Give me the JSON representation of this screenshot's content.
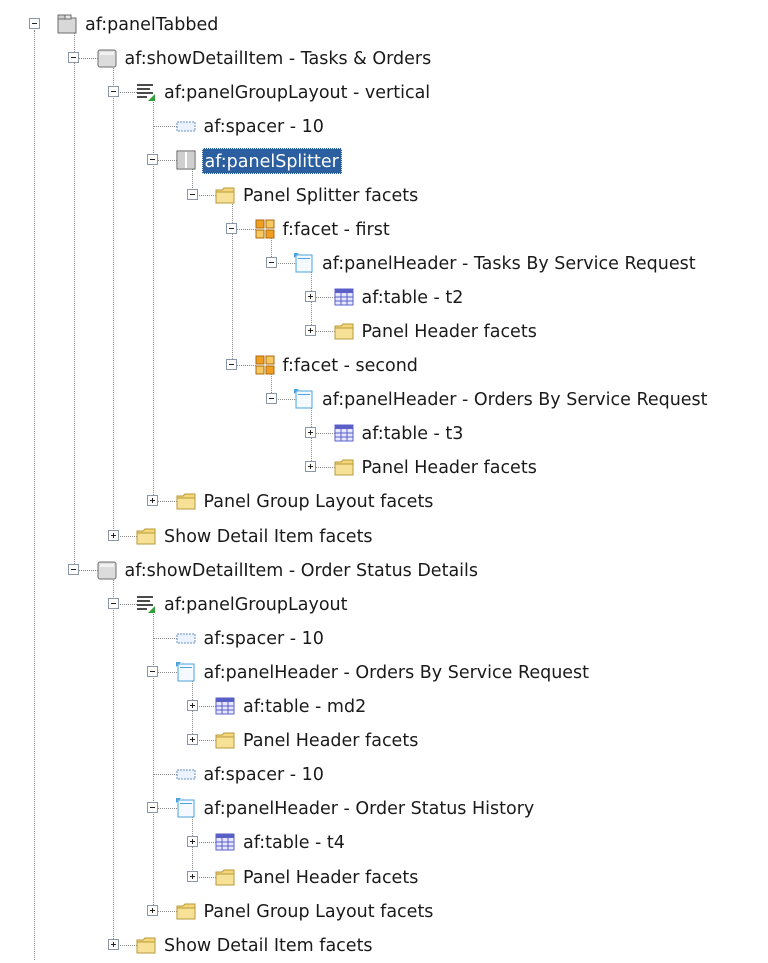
{
  "tree": {
    "nodes": [
      {
        "label": "af:panelTabbed",
        "depth": 0,
        "icon": "tabbed-icon",
        "expanded": true,
        "selected": false
      },
      {
        "label": "af:showDetailItem - Tasks & Orders",
        "depth": 1,
        "icon": "show-detail-item-icon",
        "expanded": true,
        "selected": false
      },
      {
        "label": "af:panelGroupLayout - vertical",
        "depth": 2,
        "icon": "panel-group-layout-icon",
        "expanded": true,
        "selected": false
      },
      {
        "label": "af:spacer - 10",
        "depth": 3,
        "icon": "spacer-icon",
        "expanded": null,
        "selected": false
      },
      {
        "label": "af:panelSplitter",
        "depth": 3,
        "icon": "panel-splitter-icon",
        "expanded": true,
        "selected": true
      },
      {
        "label": "Panel Splitter facets",
        "depth": 4,
        "icon": "folder-icon",
        "expanded": true,
        "selected": false
      },
      {
        "label": "f:facet - first",
        "depth": 5,
        "icon": "facet-icon",
        "expanded": true,
        "selected": false
      },
      {
        "label": "af:panelHeader - Tasks By Service Request",
        "depth": 6,
        "icon": "panel-header-icon",
        "expanded": true,
        "selected": false
      },
      {
        "label": "af:table - t2",
        "depth": 7,
        "icon": "table-icon",
        "expanded": false,
        "selected": false
      },
      {
        "label": "Panel Header facets",
        "depth": 7,
        "icon": "folder-icon",
        "expanded": false,
        "selected": false
      },
      {
        "label": "f:facet - second",
        "depth": 5,
        "icon": "facet-icon",
        "expanded": true,
        "selected": false
      },
      {
        "label": "af:panelHeader - Orders By Service Request",
        "depth": 6,
        "icon": "panel-header-icon",
        "expanded": true,
        "selected": false
      },
      {
        "label": "af:table - t3",
        "depth": 7,
        "icon": "table-icon",
        "expanded": false,
        "selected": false
      },
      {
        "label": "Panel Header facets",
        "depth": 7,
        "icon": "folder-icon",
        "expanded": false,
        "selected": false
      },
      {
        "label": "Panel Group Layout facets",
        "depth": 3,
        "icon": "folder-icon",
        "expanded": false,
        "selected": false
      },
      {
        "label": "Show Detail Item facets",
        "depth": 2,
        "icon": "folder-icon",
        "expanded": false,
        "selected": false
      },
      {
        "label": "af:showDetailItem - Order Status Details",
        "depth": 1,
        "icon": "show-detail-item-icon",
        "expanded": true,
        "selected": false
      },
      {
        "label": "af:panelGroupLayout",
        "depth": 2,
        "icon": "panel-group-layout-icon",
        "expanded": true,
        "selected": false
      },
      {
        "label": "af:spacer - 10",
        "depth": 3,
        "icon": "spacer-icon",
        "expanded": null,
        "selected": false
      },
      {
        "label": "af:panelHeader - Orders By Service Request",
        "depth": 3,
        "icon": "panel-header-icon",
        "expanded": true,
        "selected": false
      },
      {
        "label": "af:table - md2",
        "depth": 4,
        "icon": "table-icon",
        "expanded": false,
        "selected": false
      },
      {
        "label": "Panel Header facets",
        "depth": 4,
        "icon": "folder-icon",
        "expanded": false,
        "selected": false
      },
      {
        "label": "af:spacer - 10",
        "depth": 3,
        "icon": "spacer-icon",
        "expanded": null,
        "selected": false
      },
      {
        "label": "af:panelHeader - Order Status History",
        "depth": 3,
        "icon": "panel-header-icon",
        "expanded": true,
        "selected": false
      },
      {
        "label": "af:table - t4",
        "depth": 4,
        "icon": "table-icon",
        "expanded": false,
        "selected": false
      },
      {
        "label": "Panel Header facets",
        "depth": 4,
        "icon": "folder-icon",
        "expanded": false,
        "selected": false
      },
      {
        "label": "Panel Group Layout facets",
        "depth": 3,
        "icon": "folder-icon",
        "expanded": false,
        "selected": false
      },
      {
        "label": "Show Detail Item facets",
        "depth": 2,
        "icon": "folder-icon",
        "expanded": false,
        "selected": false
      }
    ]
  },
  "colors": {
    "selection_bg": "#2b5f9f",
    "folder": "#f3d77a",
    "table_icon": "#5a5fc8",
    "header_icon": "#4aa3e0",
    "facet": "#f0a020"
  }
}
